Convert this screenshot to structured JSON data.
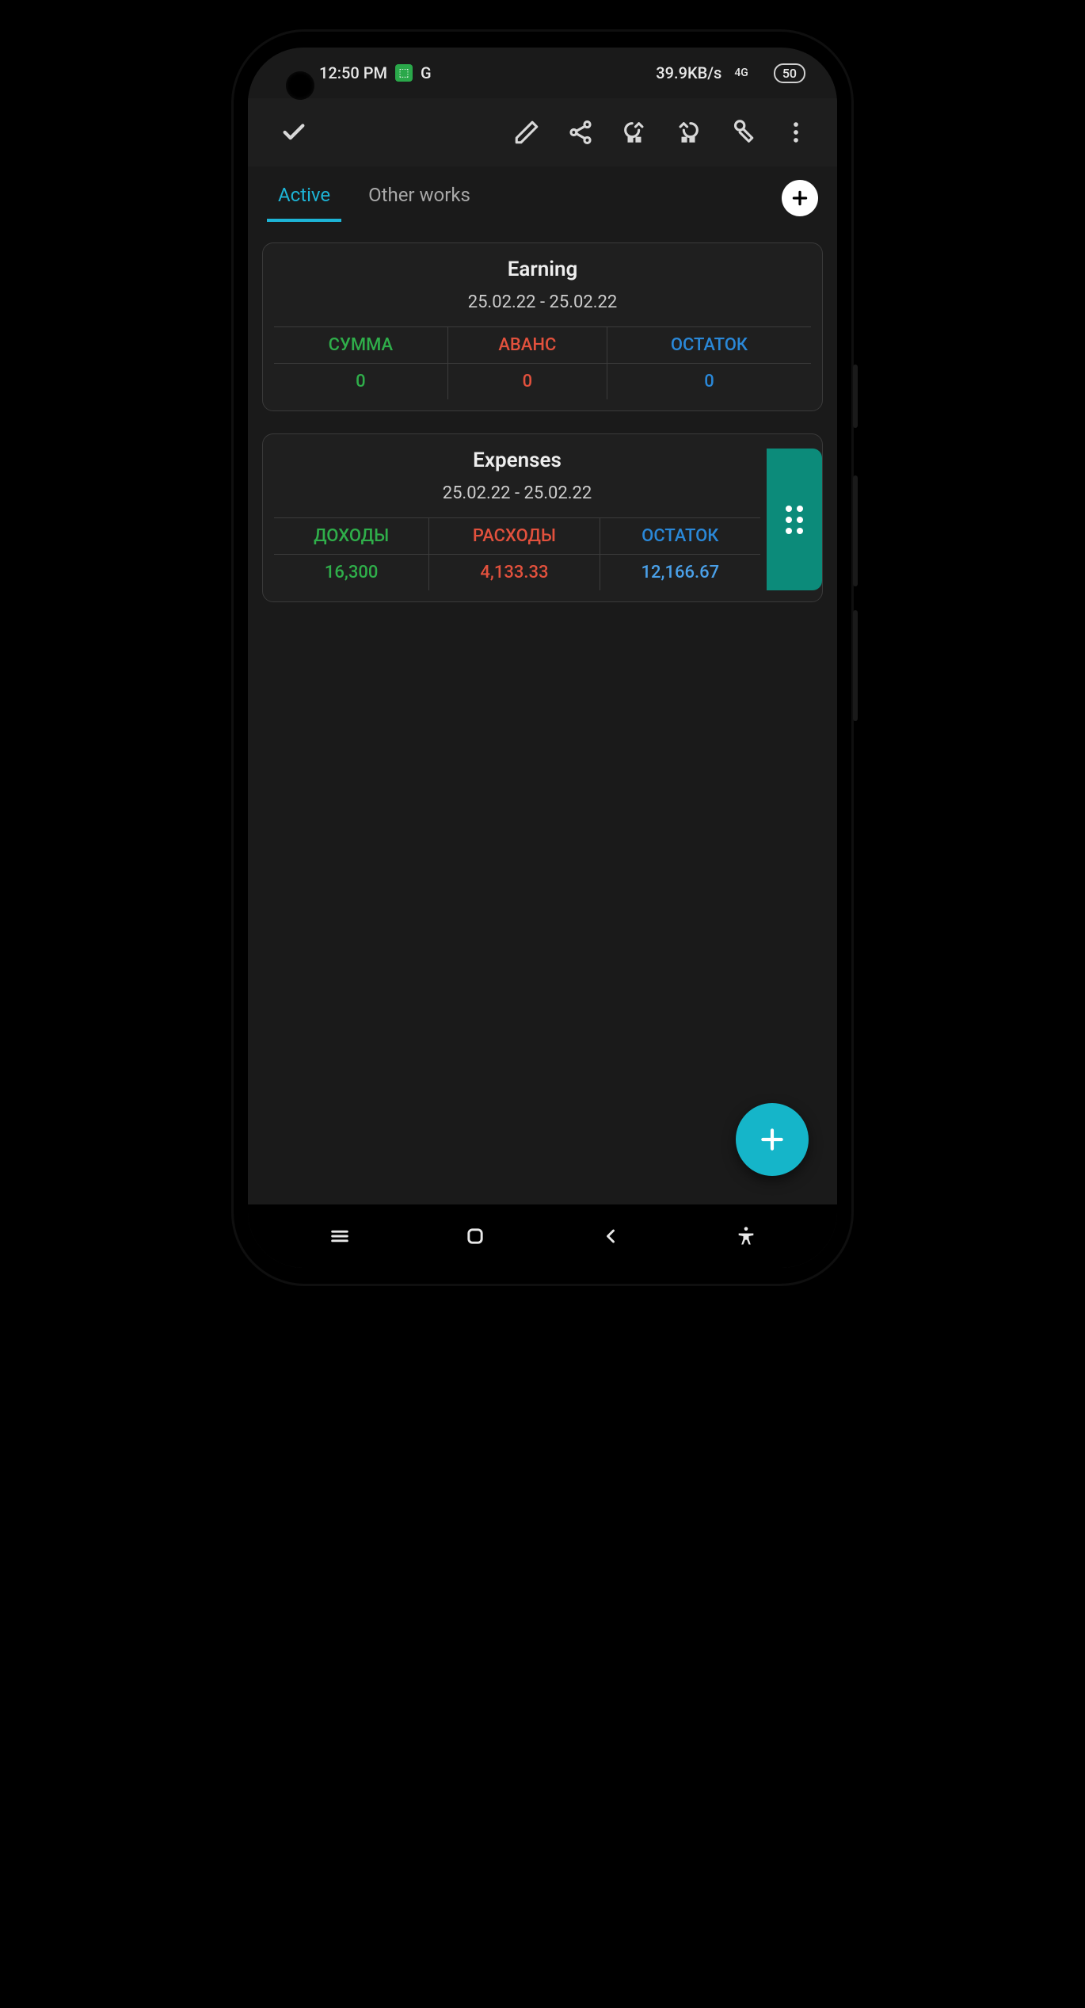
{
  "status": {
    "time": "12:50 PM",
    "g_label": "G",
    "net_speed": "39.9KB/s",
    "net_type": "4G",
    "battery": "50"
  },
  "tabs": {
    "active": "Active",
    "other": "Other works"
  },
  "cards": {
    "earning": {
      "title": "Earning",
      "dates": "25.02.22 - 25.02.22",
      "headers": {
        "sum": "СУММА",
        "advance": "АВАНС",
        "remain": "ОСТАТОК"
      },
      "values": {
        "sum": "0",
        "advance": "0",
        "remain": "0"
      }
    },
    "expenses": {
      "title": "Expenses",
      "dates": "25.02.22 - 25.02.22",
      "headers": {
        "income": "ДОХОДЫ",
        "expense": "РАСХОДЫ",
        "remain": "ОСТАТОК"
      },
      "values": {
        "income": "16,300",
        "expense": "4,133.33",
        "remain": "12,166.67"
      }
    }
  }
}
